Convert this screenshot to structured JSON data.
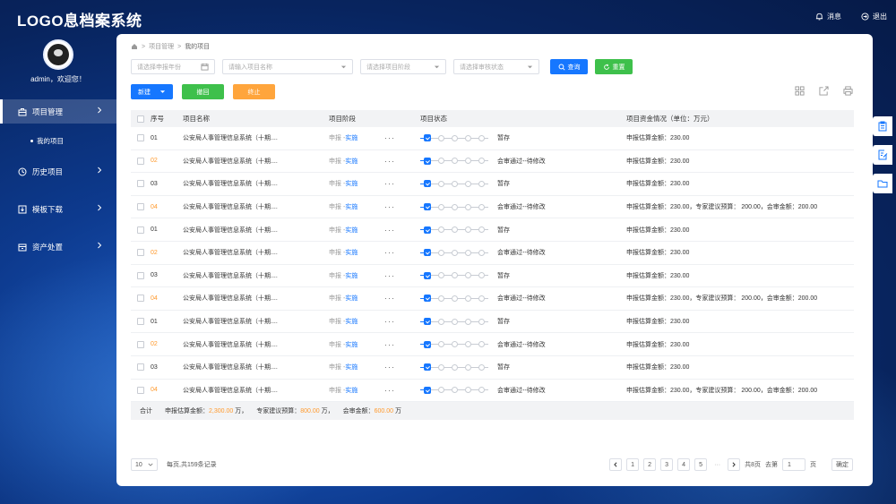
{
  "app": {
    "title": "LOGO息档案系统"
  },
  "header": {
    "messages_label": "消息",
    "logout_label": "退出"
  },
  "user": {
    "welcome": "admin，欢迎您！"
  },
  "sidebar": {
    "items": [
      {
        "label": "项目管理",
        "icon": "briefcase-icon"
      },
      {
        "label": "历史项目",
        "icon": "clock-icon"
      },
      {
        "label": "模板下载",
        "icon": "download-icon"
      },
      {
        "label": "资产处置",
        "icon": "asset-icon"
      }
    ],
    "sub_item": "我的项目"
  },
  "breadcrumb": {
    "level1": "项目管理",
    "level2": "我的项目"
  },
  "filters": {
    "year_placeholder": "请选择申报年份",
    "name_placeholder": "请输入项目名称",
    "stage_placeholder": "请选择项目阶段",
    "review_placeholder": "请选择审核状态",
    "search_label": "查询",
    "reset_label": "重置"
  },
  "actions": {
    "new_label": "新建",
    "withdraw_label": "撤回",
    "terminate_label": "终止"
  },
  "table": {
    "headers": {
      "no": "序号",
      "name": "项目名称",
      "stage": "项目阶段",
      "status": "项目状态",
      "fund": "项目资金情况（单位：万元）"
    },
    "rows": [
      {
        "no": "01",
        "name": "公安局人事管理信息系统（十期....",
        "stage_a": "申报 -",
        "stage_b": "实施",
        "more": "···",
        "status": "暂存",
        "fund": "申报估算金额：230.00"
      },
      {
        "no": "02",
        "name": "公安局人事管理信息系统（十期....",
        "stage_a": "申报 -",
        "stage_b": "实施",
        "more": "···",
        "status": "会审通过--待修改",
        "fund": "申报估算金额：230.00"
      },
      {
        "no": "03",
        "name": "公安局人事管理信息系统（十期....",
        "stage_a": "申报 -",
        "stage_b": "实施",
        "more": "···",
        "status": "暂存",
        "fund": "申报估算金额：230.00"
      },
      {
        "no": "04",
        "name": "公安局人事管理信息系统（十期....",
        "stage_a": "申报 -",
        "stage_b": "实施",
        "more": "···",
        "status": "会审通过--待修改",
        "fund": "申报估算金额：230.00，专家建议预算： 200.00，会审金额：200.00"
      },
      {
        "no": "01",
        "name": "公安局人事管理信息系统（十期....",
        "stage_a": "申报 -",
        "stage_b": "实施",
        "more": "···",
        "status": "暂存",
        "fund": "申报估算金额：230.00"
      },
      {
        "no": "02",
        "name": "公安局人事管理信息系统（十期....",
        "stage_a": "申报 -",
        "stage_b": "实施",
        "more": "···",
        "status": "会审通过--待修改",
        "fund": "申报估算金额：230.00"
      },
      {
        "no": "03",
        "name": "公安局人事管理信息系统（十期....",
        "stage_a": "申报 -",
        "stage_b": "实施",
        "more": "···",
        "status": "暂存",
        "fund": "申报估算金额：230.00"
      },
      {
        "no": "04",
        "name": "公安局人事管理信息系统（十期....",
        "stage_a": "申报 -",
        "stage_b": "实施",
        "more": "···",
        "status": "会审通过--待修改",
        "fund": "申报估算金额：230.00，专家建议预算： 200.00，会审金额：200.00"
      },
      {
        "no": "01",
        "name": "公安局人事管理信息系统（十期....",
        "stage_a": "申报 -",
        "stage_b": "实施",
        "more": "···",
        "status": "暂存",
        "fund": "申报估算金额：230.00"
      },
      {
        "no": "02",
        "name": "公安局人事管理信息系统（十期....",
        "stage_a": "申报 -",
        "stage_b": "实施",
        "more": "···",
        "status": "会审通过--待修改",
        "fund": "申报估算金额：230.00"
      },
      {
        "no": "03",
        "name": "公安局人事管理信息系统（十期....",
        "stage_a": "申报 -",
        "stage_b": "实施",
        "more": "···",
        "status": "暂存",
        "fund": "申报估算金额：230.00"
      },
      {
        "no": "04",
        "name": "公安局人事管理信息系统（十期....",
        "stage_a": "申报 -",
        "stage_b": "实施",
        "more": "···",
        "status": "会审通过--待修改",
        "fund": "申报估算金额：230.00，专家建议预算： 200.00，会审金额：200.00"
      }
    ],
    "footer": {
      "total_label": "合计",
      "est_label": "申报估算金额：",
      "est_value": "2,300.00",
      "est_unit": "万，",
      "expert_label": "专家建议预算：",
      "expert_value": "800.00",
      "expert_unit": "万，",
      "audit_label": "会审金额：",
      "audit_value": "600.00",
      "audit_unit": "万"
    }
  },
  "pagination": {
    "page_size": "10",
    "summary": "每页,共159条记录",
    "pages": [
      "1",
      "2",
      "3",
      "4",
      "5"
    ],
    "ellipsis": "···",
    "total_pages": "共8页",
    "goto_label": "去第",
    "goto_value": "1",
    "page_unit": "页",
    "confirm_label": "确定"
  },
  "colors": {
    "primary": "#1677ff",
    "success": "#3ec04b",
    "warning": "#ffa53c",
    "accent_text": "#ff9a2e"
  }
}
